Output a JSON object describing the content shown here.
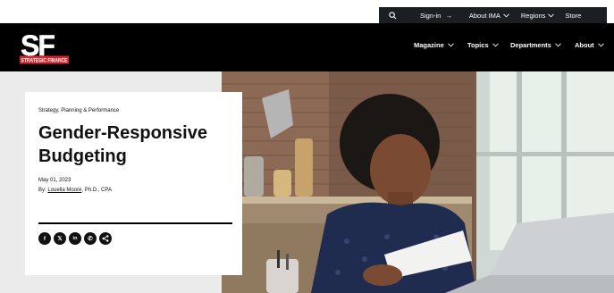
{
  "utility": {
    "search_icon": "search-icon",
    "sign_in": "Sign-in",
    "sign_in_arrow": "→",
    "about_ima": "About IMA",
    "regions": "Regions",
    "store": "Store"
  },
  "logo": {
    "letters": "SF",
    "wordmark": "STRATEGIC FINANCE"
  },
  "nav": {
    "magazine": "Magazine",
    "topics": "Topics",
    "departments": "Departments",
    "about": "About"
  },
  "article": {
    "kicker": "Strategy, Planning & Performance",
    "title": "Gender-Responsive Budgeting",
    "date": "May 01, 2023",
    "by_prefix": "By: ",
    "author": "Louella Moore",
    "author_suffix": ", Ph.D., CPA",
    "share": [
      {
        "icon": "facebook-icon",
        "glyph": "f"
      },
      {
        "icon": "x-icon",
        "glyph": "𝕏"
      },
      {
        "icon": "linkedin-icon",
        "glyph": "in"
      },
      {
        "icon": "whatsapp-icon",
        "glyph": "✆"
      },
      {
        "icon": "share-icon",
        "glyph": "<"
      }
    ]
  },
  "colors": {
    "utility_bg": "#1b1f22",
    "nav_bg": "#000000",
    "brand_red": "#d6262c",
    "hero_bg": "#ebebeb"
  }
}
